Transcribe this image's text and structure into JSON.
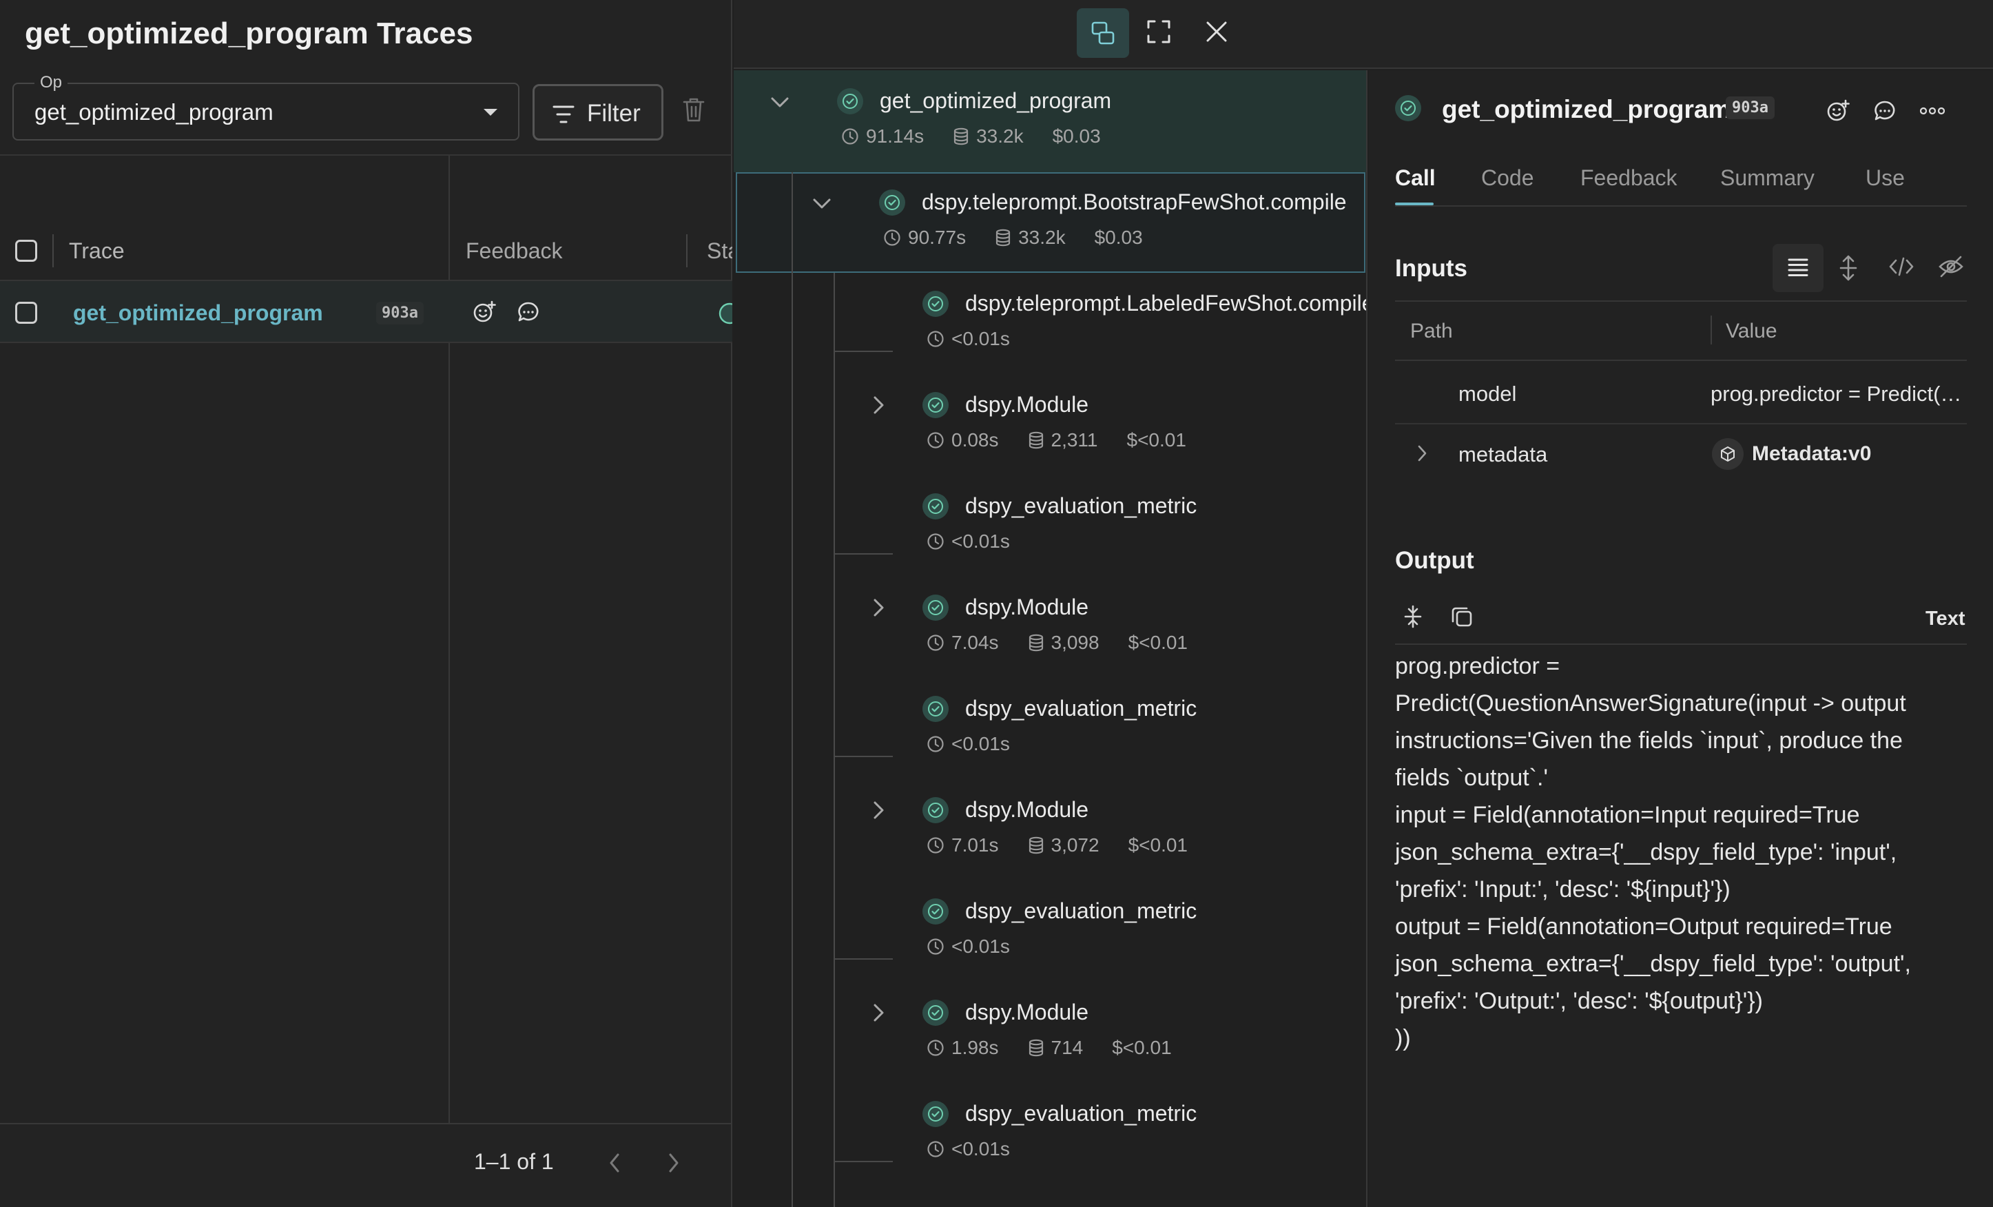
{
  "left_panel": {
    "title": "get_optimized_program Traces",
    "op_filter": {
      "label": "Op",
      "value": "get_optimized_program"
    },
    "filter_button": "Filter",
    "table": {
      "columns": [
        "Trace",
        "Feedback",
        "Status"
      ],
      "rows": [
        {
          "trace": "get_optimized_program",
          "id_badge": "903a"
        }
      ]
    },
    "pagination": "1–1 of 1"
  },
  "tree": {
    "nodes": [
      {
        "name": "get_optimized_program",
        "time": "91.14s",
        "tokens": "33.2k",
        "cost": "$0.03",
        "expandable": true,
        "expanded": true
      },
      {
        "name": "dspy.teleprompt.BootstrapFewShot.compile",
        "time": "90.77s",
        "tokens": "33.2k",
        "cost": "$0.03",
        "expandable": true,
        "expanded": true,
        "selected": true
      },
      {
        "name": "dspy.teleprompt.LabeledFewShot.compile",
        "time": "<0.01s",
        "tokens": "",
        "cost": "",
        "expandable": false
      },
      {
        "name": "dspy.Module",
        "time": "0.08s",
        "tokens": "2,311",
        "cost": "$<0.01",
        "expandable": true
      },
      {
        "name": "dspy_evaluation_metric",
        "time": "<0.01s",
        "tokens": "",
        "cost": "",
        "expandable": false
      },
      {
        "name": "dspy.Module",
        "time": "7.04s",
        "tokens": "3,098",
        "cost": "$<0.01",
        "expandable": true
      },
      {
        "name": "dspy_evaluation_metric",
        "time": "<0.01s",
        "tokens": "",
        "cost": "",
        "expandable": false
      },
      {
        "name": "dspy.Module",
        "time": "7.01s",
        "tokens": "3,072",
        "cost": "$<0.01",
        "expandable": true
      },
      {
        "name": "dspy_evaluation_metric",
        "time": "<0.01s",
        "tokens": "",
        "cost": "",
        "expandable": false
      },
      {
        "name": "dspy.Module",
        "time": "1.98s",
        "tokens": "714",
        "cost": "$<0.01",
        "expandable": true
      },
      {
        "name": "dspy_evaluation_metric",
        "time": "<0.01s",
        "tokens": "",
        "cost": "",
        "expandable": false
      }
    ]
  },
  "detail": {
    "title": "get_optimized_program",
    "id_badge": "903a",
    "tabs": [
      "Call",
      "Code",
      "Feedback",
      "Summary",
      "Use"
    ],
    "active_tab": "Call",
    "inputs": {
      "title": "Inputs",
      "columns": [
        "Path",
        "Value"
      ],
      "rows": [
        {
          "path": "model",
          "value": "prog.predictor = Predict(QuestionAnswerSignature(input -> output"
        },
        {
          "path": "metadata",
          "value": "Metadata:v0",
          "expandable": true
        }
      ]
    },
    "output": {
      "title": "Output",
      "format": "Text",
      "lines": [
        "prog.predictor =",
        "Predict(QuestionAnswerSignature(input -> output",
        "   instructions='Given the fields `input`, produce the",
        "fields `output`.'",
        "   input = Field(annotation=Input required=True",
        "json_schema_extra={'__dspy_field_type': 'input',",
        "'prefix': 'Input:', 'desc': '${input}'})",
        "   output = Field(annotation=Output required=True",
        "json_schema_extra={'__dspy_field_type': 'output',",
        "'prefix': 'Output:', 'desc': '${output}'})",
        "))"
      ]
    }
  },
  "colors": {
    "accent": "#6ab7c6",
    "success": "#6fcfb0",
    "selected_row_bg": "#243532",
    "background": "#202020"
  },
  "icons": {
    "status": "check-circle-icon",
    "filter": "filter-lines-icon",
    "trash": "trash-icon",
    "react": "add-reaction-icon",
    "comment": "comment-icon",
    "time": "clock-icon",
    "tokens": "database-icon",
    "split_view": "split-view-icon",
    "expand": "fullscreen-icon",
    "close": "close-icon",
    "more": "more-horizontal-icon",
    "metadata": "cube-icon"
  }
}
